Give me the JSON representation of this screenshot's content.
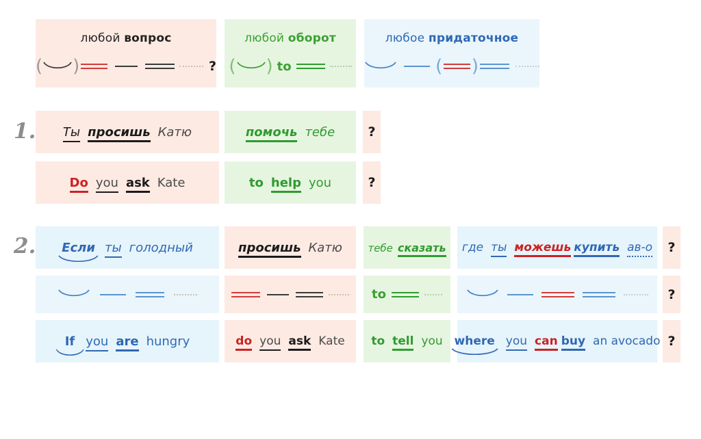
{
  "colors": {
    "pink_bg": "#fdeae3",
    "green_bg": "#e6f5e0",
    "blue_bg": "#e6f4fb",
    "pale_blue_bg": "#eaf6fc",
    "red": "#cc2222",
    "green": "#2f9b2f",
    "blue": "#2f68b5",
    "black": "#1b1b1b",
    "gray_number": "#8d8d8d"
  },
  "legend": {
    "question": {
      "pre": "любой",
      "key": "вопрос",
      "qmark": "?"
    },
    "infinitive": {
      "pre": "любой",
      "key": "оборот",
      "to": "to"
    },
    "clause": {
      "pre": "любое",
      "key": "придаточное"
    }
  },
  "rows": [
    {
      "number": "1.",
      "ru": {
        "main": [
          {
            "text": "Ты",
            "style": "underline",
            "color": "black"
          },
          {
            "text": "просишь",
            "style": "bold-underline",
            "color": "black"
          },
          {
            "text": "Катю",
            "style": "plain",
            "color": "gray"
          }
        ],
        "inf": [
          {
            "text": "помочь",
            "style": "bold-underline",
            "color": "green"
          },
          {
            "text": "тебе",
            "style": "plain",
            "color": "green"
          }
        ],
        "qmark": "?"
      },
      "en": {
        "main": [
          {
            "text": "Do",
            "style": "bold-underline",
            "color": "red"
          },
          {
            "text": "you",
            "style": "underline",
            "color": "gray"
          },
          {
            "text": "ask",
            "style": "bold-underline",
            "color": "black"
          },
          {
            "text": "Kate",
            "style": "plain",
            "color": "gray"
          }
        ],
        "inf": [
          {
            "text": "to",
            "style": "plain",
            "color": "green"
          },
          {
            "text": "help",
            "style": "bold-underline",
            "color": "green"
          },
          {
            "text": "you",
            "style": "plain",
            "color": "green"
          }
        ],
        "qmark": "?"
      }
    },
    {
      "number": "2.",
      "ru": {
        "clause_front": [
          {
            "text": "Если",
            "style": "swoosh",
            "color": "blue"
          },
          {
            "text": "ты",
            "style": "underline",
            "color": "blue"
          },
          {
            "text": "голодный",
            "style": "plain",
            "color": "blue"
          }
        ],
        "main": [
          {
            "text": "просишь",
            "style": "bold-underline",
            "color": "black"
          },
          {
            "text": "Катю",
            "style": "plain",
            "color": "gray"
          }
        ],
        "inf": [
          {
            "text": "тебе",
            "style": "plain-small",
            "color": "green"
          },
          {
            "text": "сказать",
            "style": "bold-underline",
            "color": "green"
          }
        ],
        "clause_tail": [
          {
            "text": "где",
            "style": "plain",
            "color": "blue"
          },
          {
            "text": "ты",
            "style": "underline",
            "color": "blue"
          },
          {
            "text": "можешь",
            "style": "bold-underline",
            "color": "red"
          },
          {
            "text": "купить",
            "style": "bold-underline",
            "color": "blue"
          },
          {
            "text": "ав-о",
            "style": "dotted-underline",
            "color": "blue"
          }
        ],
        "qmark": "?"
      },
      "en": {
        "clause_front": [
          {
            "text": "If",
            "style": "bold-swoosh",
            "color": "blue"
          },
          {
            "text": "you",
            "style": "underline",
            "color": "blue"
          },
          {
            "text": "are",
            "style": "bold-underline",
            "color": "blue"
          },
          {
            "text": "hungry",
            "style": "plain",
            "color": "blue"
          }
        ],
        "main": [
          {
            "text": "do",
            "style": "bold-underline",
            "color": "red"
          },
          {
            "text": "you",
            "style": "underline",
            "color": "gray"
          },
          {
            "text": "ask",
            "style": "bold-underline",
            "color": "black"
          },
          {
            "text": "Kate",
            "style": "plain",
            "color": "gray"
          }
        ],
        "inf": [
          {
            "text": "to",
            "style": "plain",
            "color": "green"
          },
          {
            "text": "tell",
            "style": "bold-underline",
            "color": "green"
          },
          {
            "text": "you",
            "style": "plain",
            "color": "green"
          }
        ],
        "clause_tail": [
          {
            "text": "where",
            "style": "bold-swoosh",
            "color": "blue"
          },
          {
            "text": "you",
            "style": "underline",
            "color": "blue"
          },
          {
            "text": "can",
            "style": "bold-underline",
            "color": "red"
          },
          {
            "text": "buy",
            "style": "bold-underline",
            "color": "blue"
          },
          {
            "text": "an avocado",
            "style": "plain",
            "color": "blue"
          }
        ],
        "qmark": "?"
      },
      "qmarks": [
        "?",
        "?",
        "?"
      ]
    }
  ]
}
